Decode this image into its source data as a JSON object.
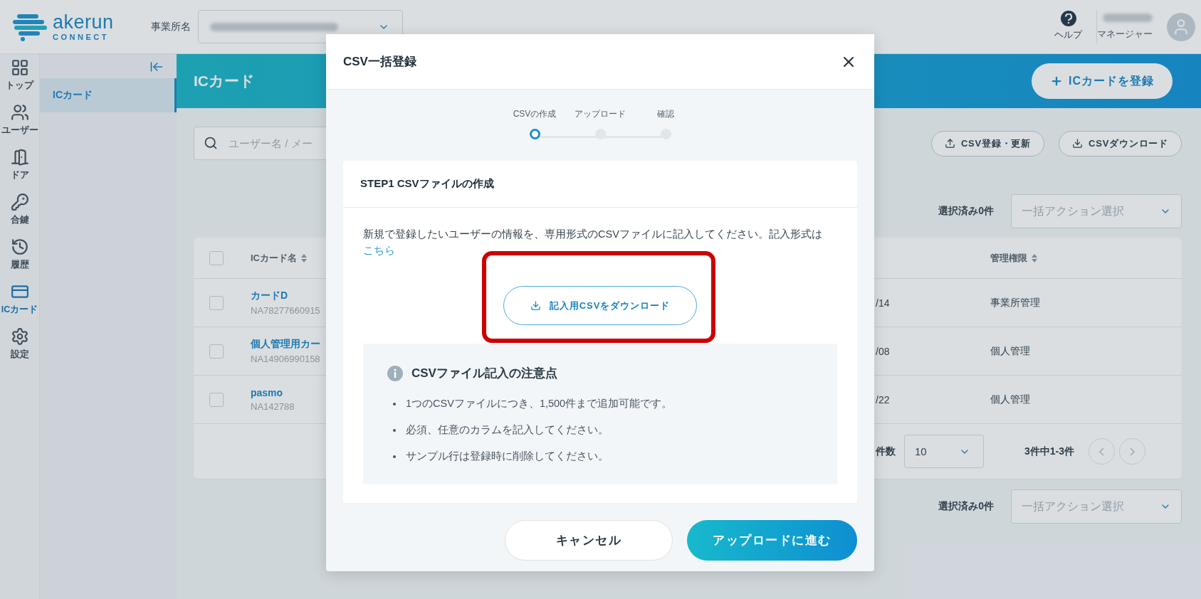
{
  "header": {
    "logo_primary": "akerun",
    "logo_secondary": "CONNECT",
    "office_label": "事業所名",
    "help_label": "ヘルプ",
    "user_role": "マネージャー"
  },
  "nav_rail": [
    {
      "label": "トップ",
      "kind": "top",
      "selected": false
    },
    {
      "label": "ユーザー",
      "kind": "users",
      "selected": false
    },
    {
      "label": "ドア",
      "kind": "door",
      "selected": false
    },
    {
      "label": "合鍵",
      "kind": "key",
      "selected": false
    },
    {
      "label": "履歴",
      "kind": "history",
      "selected": false
    },
    {
      "label": "ICカード",
      "kind": "card",
      "selected": true
    },
    {
      "label": "設定",
      "kind": "settings",
      "selected": false
    }
  ],
  "side_menu": [
    {
      "label": "ICカード",
      "selected": true
    }
  ],
  "page": {
    "title": "ICカード",
    "register_button": "ICカードを登録",
    "search_placeholder": "ユーザー名 / メー",
    "toolbar": [
      {
        "label": "CSV登録・更新",
        "kind": "upload"
      },
      {
        "label": "CSVダウンロード",
        "kind": "download"
      }
    ]
  },
  "bulk_top": {
    "selected_count": "選択済み0件",
    "action_placeholder": "一括アクション選択"
  },
  "table": {
    "all_checked": false,
    "columns": [
      "ICカード名",
      "管理権限"
    ],
    "rows": [
      {
        "name": "カードD",
        "number": "NA78277660915",
        "date": "/14",
        "role": "事業所管理",
        "checked": false
      },
      {
        "name": "個人管理用カー",
        "number": "NA14906990158",
        "date": "/08",
        "role": "個人管理",
        "checked": false
      },
      {
        "name": "pasmo",
        "number": "NA142788",
        "date": "/22",
        "role": "個人管理",
        "checked": false
      }
    ]
  },
  "pagination": {
    "per_page_label": "件数",
    "per_page": "10",
    "range": "3件中1-3件"
  },
  "bulk_bottom": {
    "selected_count": "選択済み0件",
    "action_placeholder": "一括アクション選択"
  },
  "modal": {
    "title": "CSV一括登録",
    "steps": [
      {
        "label": "CSVの作成",
        "selected": true
      },
      {
        "label": "アップロード",
        "selected": false
      },
      {
        "label": "確認",
        "selected": false
      }
    ],
    "step_title": "STEP1 CSVファイルの作成",
    "description": "新規で登録したいユーザーの情報を、専用形式のCSVファイルに記入してください。記入形式は",
    "description_link": "こちら",
    "download_button": "記入用CSVをダウンロード",
    "notes_title": "CSVファイル記入の注意点",
    "notes": [
      "1つのCSVファイルにつき、1,500件まで追加可能です。",
      "必須、任意のカラムを記入してください。",
      "サンプル行は登録時に削除してください。"
    ],
    "cancel_button": "キャンセル",
    "next_button": "アップロードに進む"
  }
}
